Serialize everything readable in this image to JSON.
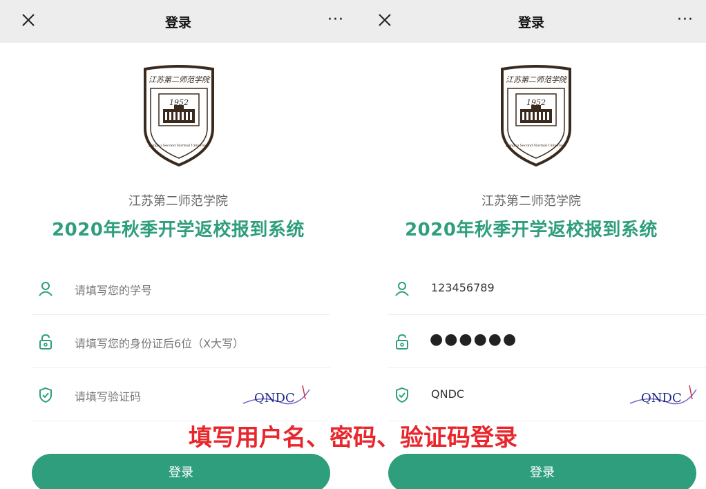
{
  "left": {
    "topbar": {
      "title": "登录",
      "more": "···"
    },
    "school_name": "江苏第二师范学院",
    "system_title": "2020年秋季开学返校报到系统",
    "student_id": {
      "placeholder": "请填写您的学号"
    },
    "password": {
      "placeholder": "请填写您的身份证后6位（X大写）"
    },
    "captcha": {
      "placeholder": "请填写验证码",
      "image_text": "QNDC"
    },
    "login_button": "登录"
  },
  "right": {
    "topbar": {
      "title": "登录",
      "more": "···"
    },
    "school_name": "江苏第二师范学院",
    "system_title": "2020年秋季开学返校报到系统",
    "student_id": {
      "value": "123456789"
    },
    "password": {
      "value": "●●●●●●"
    },
    "captcha": {
      "value": "QNDC",
      "image_text": "QNDC"
    },
    "login_button": "登录"
  },
  "emblem": {
    "top_text": "江苏第二师范学院",
    "year": "1952",
    "ring_text": "Jiangsu Second Normal University"
  },
  "annotation": "填写用户名、密码、验证码登录",
  "colors": {
    "accent": "#2e9e7d",
    "annotation": "#e8262b",
    "topbar": "#ededed"
  },
  "icons": [
    "close-icon",
    "more-icon",
    "user-icon",
    "lock-icon",
    "shield-check-icon"
  ]
}
